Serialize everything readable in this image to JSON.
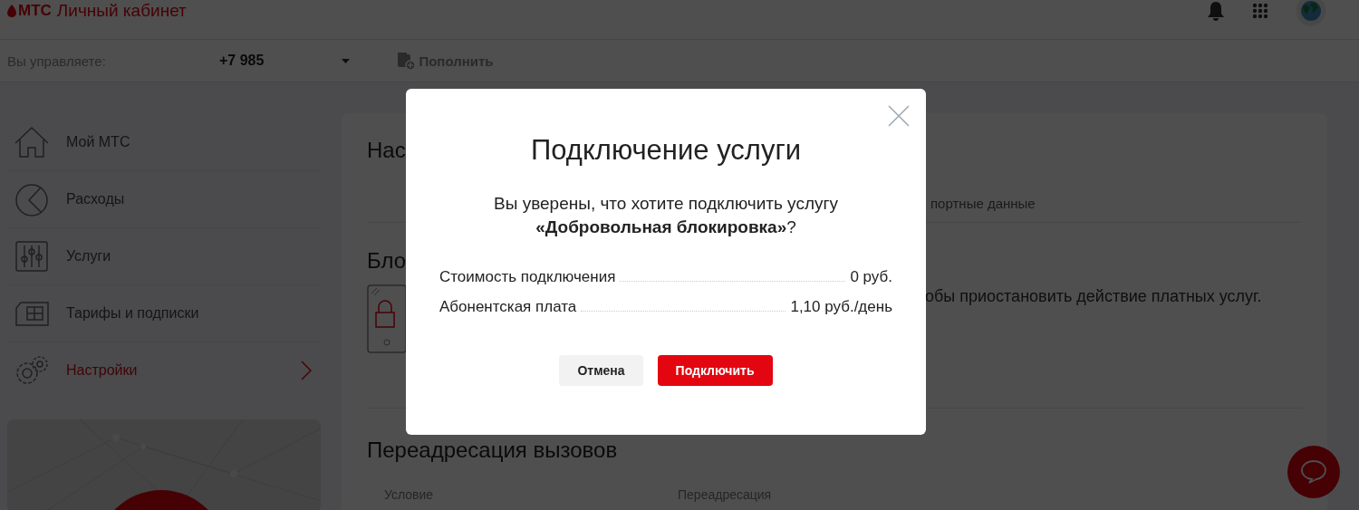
{
  "header": {
    "logo": "МТС",
    "title": "Личный кабинет"
  },
  "account_bar": {
    "label": "Вы управляете:",
    "number": "+7 985",
    "top_up": "Пополнить"
  },
  "sidebar": {
    "items": [
      {
        "label": "Мой МТС",
        "selected": false
      },
      {
        "label": "Расходы",
        "selected": false
      },
      {
        "label": "Услуги",
        "selected": false
      },
      {
        "label": "Тарифы и подписки",
        "selected": false
      },
      {
        "label": "Настройки",
        "selected": true
      }
    ]
  },
  "main": {
    "heading_1": "Нас",
    "tab": "портные данные",
    "heading_2": "Бло",
    "description": "обы приостановить действие платных услуг.",
    "heading_3": "Переадресация вызовов",
    "columns": [
      "Условие",
      "Переадресация"
    ]
  },
  "modal": {
    "title": "Подключение услуги",
    "question": "Вы уверены, что хотите подключить услугу",
    "service": "**«Добровольная блокировка»**?",
    "rows": [
      {
        "label": "Стоимость подключения",
        "value": "0 руб."
      },
      {
        "label": "Абонентская плата",
        "value": "1,10 руб./день"
      }
    ],
    "buttons": [
      {
        "label": "Отмена",
        "kind": "secondary"
      },
      {
        "label": "Подключить",
        "kind": "primary"
      }
    ]
  }
}
